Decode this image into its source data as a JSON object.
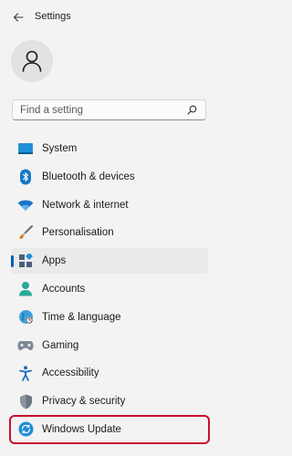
{
  "window": {
    "title": "Settings"
  },
  "search": {
    "placeholder": "Find a setting"
  },
  "nav": {
    "items": [
      {
        "label": "System",
        "icon": "system-icon"
      },
      {
        "label": "Bluetooth & devices",
        "icon": "bluetooth-icon"
      },
      {
        "label": "Network & internet",
        "icon": "network-icon"
      },
      {
        "label": "Personalisation",
        "icon": "brush-icon"
      },
      {
        "label": "Apps",
        "icon": "apps-icon",
        "selected": true
      },
      {
        "label": "Accounts",
        "icon": "accounts-icon"
      },
      {
        "label": "Time & language",
        "icon": "globe-icon"
      },
      {
        "label": "Gaming",
        "icon": "gamepad-icon"
      },
      {
        "label": "Accessibility",
        "icon": "accessibility-icon"
      },
      {
        "label": "Privacy & security",
        "icon": "shield-icon"
      },
      {
        "label": "Windows Update",
        "icon": "update-icon",
        "highlighted": true
      }
    ]
  },
  "colors": {
    "accent": "#005fb8",
    "highlight_box": "#c8102e",
    "background": "#f3f3f3"
  }
}
